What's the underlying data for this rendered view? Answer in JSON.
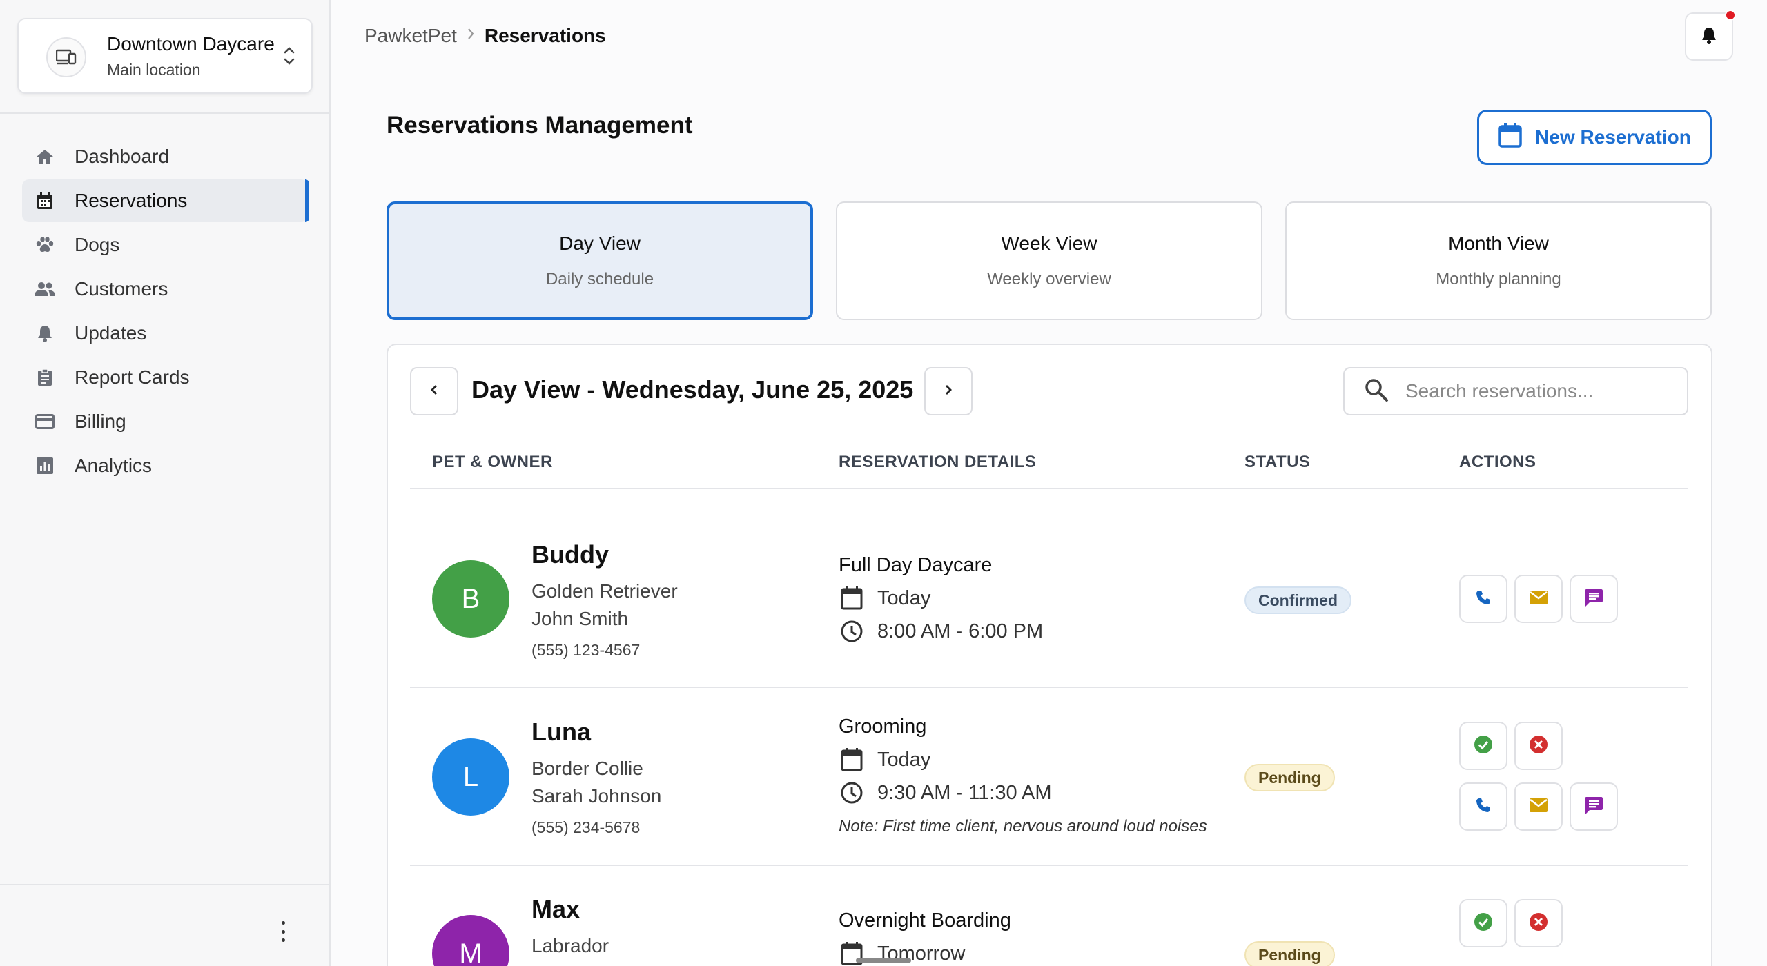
{
  "location": {
    "name": "Downtown Daycare",
    "subtitle": "Main location"
  },
  "sidebar": {
    "items": [
      {
        "label": "Dashboard",
        "icon": "home-icon",
        "active": false
      },
      {
        "label": "Reservations",
        "icon": "calendar-icon",
        "active": true
      },
      {
        "label": "Dogs",
        "icon": "paw-icon",
        "active": false
      },
      {
        "label": "Customers",
        "icon": "people-icon",
        "active": false
      },
      {
        "label": "Updates",
        "icon": "bell-icon",
        "active": false
      },
      {
        "label": "Report Cards",
        "icon": "clipboard-icon",
        "active": false
      },
      {
        "label": "Billing",
        "icon": "credit-card-icon",
        "active": false
      },
      {
        "label": "Analytics",
        "icon": "chart-icon",
        "active": false
      }
    ]
  },
  "breadcrumb": {
    "root": "PawketPet",
    "separator": ">",
    "current": "Reservations"
  },
  "page": {
    "title": "Reservations Management",
    "new_button": "New Reservation"
  },
  "views": [
    {
      "title": "Day View",
      "subtitle": "Daily schedule",
      "active": true
    },
    {
      "title": "Week View",
      "subtitle": "Weekly overview",
      "active": false
    },
    {
      "title": "Month View",
      "subtitle": "Monthly planning",
      "active": false
    }
  ],
  "day_header": {
    "title": "Day View - Wednesday, June 25, 2025"
  },
  "search": {
    "placeholder": "Search reservations..."
  },
  "table": {
    "headers": {
      "pet_owner": "PET & OWNER",
      "details": "RESERVATION DETAILS",
      "status": "STATUS",
      "actions": "ACTIONS"
    },
    "rows": [
      {
        "initial": "B",
        "avatar_color": "#43a047",
        "name": "Buddy",
        "breed": "Golden Retriever",
        "owner": "John Smith",
        "phone": "(555) 123-4567",
        "service": "Full Day Daycare",
        "date": "Today",
        "time": "8:00 AM - 6:00 PM",
        "note": "",
        "status": "Confirmed"
      },
      {
        "initial": "L",
        "avatar_color": "#1e88e5",
        "name": "Luna",
        "breed": "Border Collie",
        "owner": "Sarah Johnson",
        "phone": "(555) 234-5678",
        "service": "Grooming",
        "date": "Today",
        "time": "9:30 AM - 11:30 AM",
        "note": "Note: First time client, nervous around loud noises",
        "status": "Pending"
      },
      {
        "initial": "M",
        "avatar_color": "#8e24aa",
        "name": "Max",
        "breed": "Labrador",
        "service": "Overnight Boarding",
        "date": "Tomorrow",
        "status": "Pending"
      }
    ]
  },
  "colors": {
    "accent": "#1c6ed1",
    "call": "#1565c0",
    "email": "#d4a106",
    "message": "#8e24aa",
    "approve": "#43a047",
    "decline": "#d32f2f"
  }
}
